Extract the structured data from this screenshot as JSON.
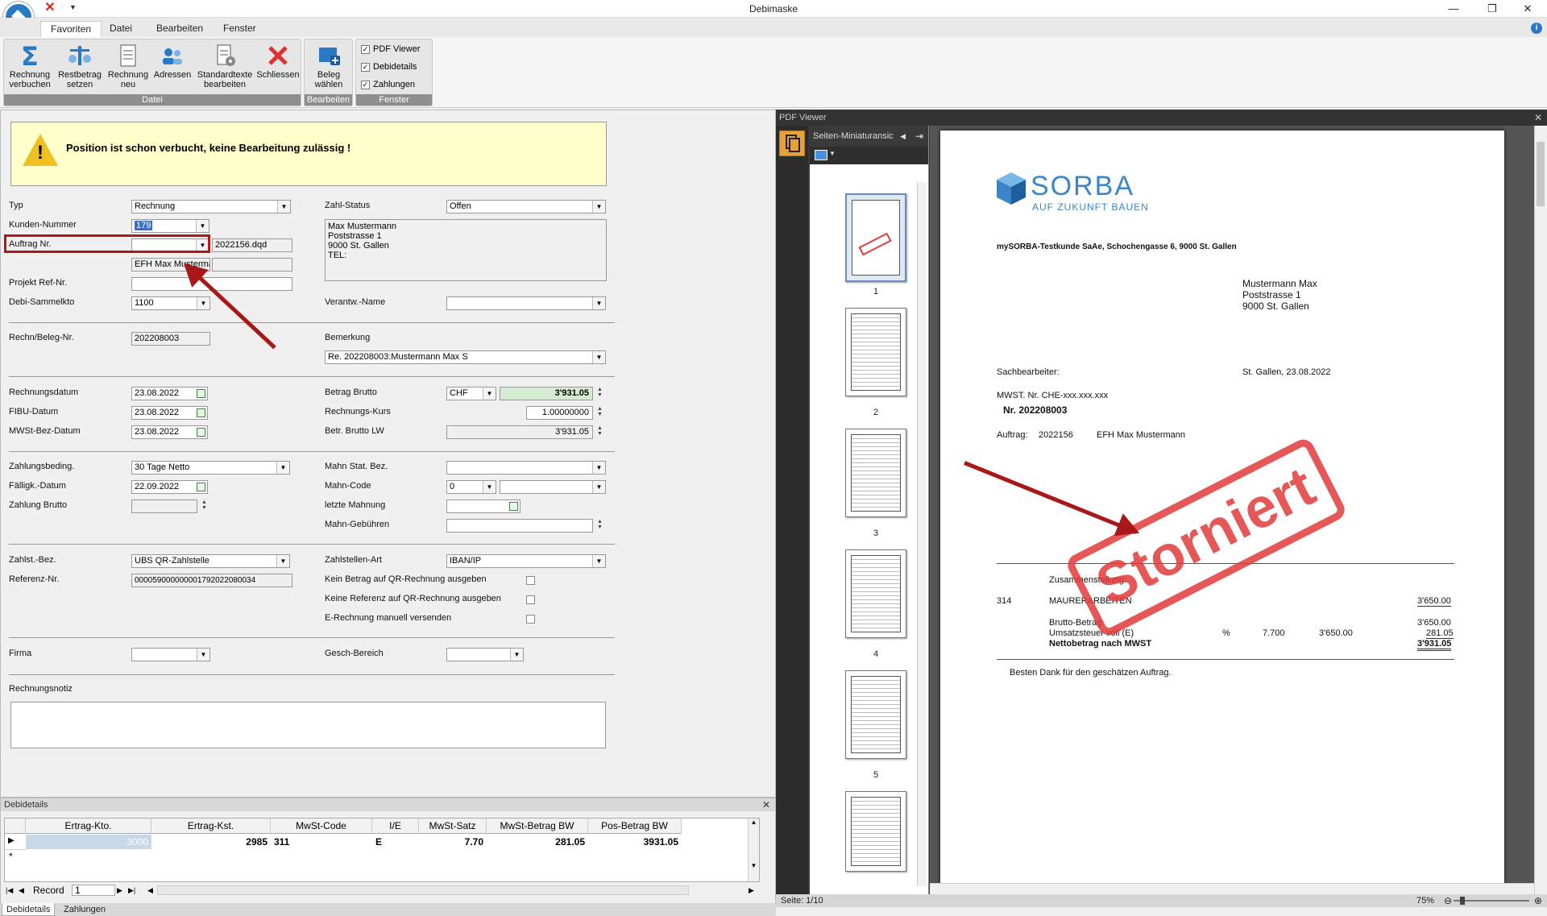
{
  "window": {
    "title": "Debimaske",
    "minimize": "—",
    "restore": "❐",
    "close": "✕"
  },
  "ribbon": {
    "tabs": [
      "Favoriten",
      "Datei",
      "Bearbeiten",
      "Fenster"
    ],
    "datei_group": {
      "label": "Datei",
      "buttons": [
        "Rechnung verbuchen",
        "Restbetrag setzen",
        "Rechnung neu",
        "Adressen",
        "Standardtexte bearbeiten",
        "Schliessen"
      ]
    },
    "bearbeiten_group": {
      "label": "Bearbeiten",
      "buttons": [
        "Beleg wählen"
      ]
    },
    "fenster_group": {
      "label": "Fenster",
      "checkboxes": [
        "PDF Viewer",
        "Debidetails",
        "Zahlungen"
      ]
    }
  },
  "warning": {
    "text": "Position ist schon verbucht, keine Bearbeitung zulässig !"
  },
  "form": {
    "typ": {
      "label": "Typ",
      "value": "Rechnung"
    },
    "kunden_nummer": {
      "label": "Kunden-Nummer",
      "value": "179"
    },
    "auftrag_nr": {
      "label": "Auftrag Nr.",
      "value": "",
      "file": "2022156.dqd",
      "desc": "EFH Max Mustermann"
    },
    "projekt_ref": {
      "label": "Projekt Ref-Nr.",
      "value": ""
    },
    "debi_sammelkto": {
      "label": "Debi-Sammelkto",
      "value": "1100"
    },
    "zahl_status": {
      "label": "Zahl-Status",
      "value": "Offen"
    },
    "address": [
      "Max Mustermann",
      "Poststrasse 1",
      "9000 St. Gallen",
      "TEL:"
    ],
    "verantw_name": {
      "label": "Verantw.-Name",
      "value": ""
    },
    "rechn_beleg_nr": {
      "label": "Rechn/Beleg-Nr.",
      "value": "202208003"
    },
    "bemerkung": {
      "label": "Bemerkung",
      "value": "Re. 202208003:Mustermann Max S"
    },
    "rechnungsdatum": {
      "label": "Rechnungsdatum",
      "value": "23.08.2022"
    },
    "fibu_datum": {
      "label": "FIBU-Datum",
      "value": "23.08.2022"
    },
    "mwst_bez_datum": {
      "label": "MWSt-Bez-Datum",
      "value": "23.08.2022"
    },
    "betrag_brutto": {
      "label": "Betrag Brutto",
      "currency": "CHF",
      "value": "3'931.05"
    },
    "rechnungs_kurs": {
      "label": "Rechnungs-Kurs",
      "value": "1.00000000"
    },
    "betr_brutto_lw": {
      "label": "Betr. Brutto LW",
      "value": "3'931.05"
    },
    "zahlungsbeding": {
      "label": "Zahlungsbeding.",
      "value": "30 Tage Netto"
    },
    "faelligk_datum": {
      "label": "Fälligk.-Datum",
      "value": "22.09.2022"
    },
    "zahlung_brutto": {
      "label": "Zahlung Brutto",
      "value": ""
    },
    "mahn_stat_bez": {
      "label": "Mahn Stat. Bez.",
      "value": ""
    },
    "mahn_code": {
      "label": "Mahn-Code",
      "value": "0"
    },
    "letzte_mahnung": {
      "label": "letzte Mahnung",
      "value": ""
    },
    "mahn_gebuehren": {
      "label": "Mahn-Gebühren",
      "value": ""
    },
    "zahlst_bez": {
      "label": "Zahlst.-Bez.",
      "value": "UBS QR-Zahlstelle"
    },
    "referenz_nr": {
      "label": "Referenz-Nr.",
      "value": "000059000000001792022080034"
    },
    "zahlstellen_art": {
      "label": "Zahlstellen-Art",
      "value": "IBAN/IP"
    },
    "kein_betrag": {
      "label": "Kein Betrag auf QR-Rechnung ausgeben"
    },
    "keine_referenz": {
      "label": "Keine Referenz auf QR-Rechnung ausgeben"
    },
    "e_rechnung": {
      "label": "E-Rechnung manuell versenden"
    },
    "firma": {
      "label": "Firma",
      "value": ""
    },
    "gesch_bereich": {
      "label": "Gesch-Bereich",
      "value": ""
    },
    "rechnungsnotiz": {
      "label": "Rechnungsnotiz",
      "value": ""
    }
  },
  "debidetails": {
    "title": "Debidetails",
    "columns": [
      "Ertrag-Kto.",
      "Ertrag-Kst.",
      "MwSt-Code",
      "I/E",
      "MwSt-Satz",
      "MwSt-Betrag BW",
      "Pos-Betrag BW"
    ],
    "row": [
      "3000",
      "2985",
      "311",
      "E",
      "7.70",
      "281.05",
      "3931.05"
    ],
    "record_label": "Record",
    "record_value": "1"
  },
  "bottom_tabs": [
    "Debidetails",
    "Zahlungen"
  ],
  "pdf": {
    "title": "PDF Viewer",
    "thumb_header": "Seiten-Miniaturansic",
    "thumb_pages": [
      "1",
      "2",
      "3",
      "4",
      "5"
    ],
    "status": "Seite: 1/10",
    "zoom": "75%"
  },
  "document": {
    "logo_text": "SORBA",
    "logo_sub": "AUF ZUKUNFT BAUEN",
    "sender": "mySORBA-Testkunde SaAe, Schochengasse 6, 9000  St. Gallen",
    "recipient": [
      "Mustermann Max",
      "Poststrasse 1",
      "9000 St. Gallen"
    ],
    "sachbearbeiter": "Sachbearbeiter:",
    "ort_datum": "St. Gallen, 23.08.2022",
    "mwst_nr": "MWST. Nr. CHE-xxx.xxx.xxx",
    "nr": "Nr.  202208003",
    "auftrag_label": "Auftrag:",
    "auftrag_nr": "2022156",
    "auftrag_desc": "EFH Max Mustermann",
    "zusammenstellung": "Zusammenstellung:",
    "pos_nr": "314",
    "pos_desc": "MAURERARBEITEN",
    "pos_amount": "3'650.00",
    "brutto_label": "Brutto-Betrag",
    "brutto_amount": "3'650.00",
    "ust_label": "Umsatzsteuer voll (E)",
    "ust_pct": "%",
    "ust_rate": "7.700",
    "ust_base": "3'650.00",
    "ust_amount": "281.05",
    "netto_label": "Nettobetrag nach MWST",
    "netto_amount": "3'931.05",
    "thanks": "Besten Dank für den geschätzen Auftrag.",
    "stamp": "Storniert"
  },
  "colors": {
    "accent": "#2a79c4",
    "warning_bg": "#ffffcc",
    "annotation_red": "#a81818",
    "stamp_red": "#e23b3b",
    "brutto_bg": "#d6ecd0"
  }
}
